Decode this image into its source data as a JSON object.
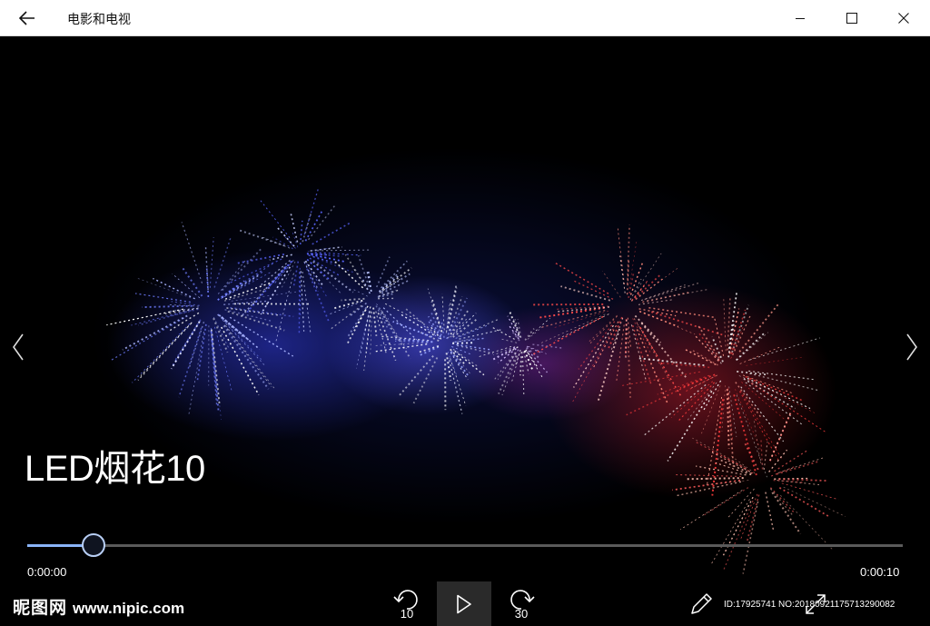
{
  "window": {
    "title": "电影和电视"
  },
  "icons": {
    "back": "back-arrow-icon",
    "minimize": "minimize-icon",
    "maximize": "maximize-icon",
    "close": "close-icon",
    "previous": "chevron-left-icon",
    "next": "chevron-right-icon",
    "skip_back": "skip-back-10-icon",
    "play": "play-icon",
    "skip_forward": "skip-forward-30-icon",
    "edit": "pencil-icon",
    "fullscreen": "expand-icon"
  },
  "video": {
    "title": "LED烟花10",
    "progress": 0.075
  },
  "playback": {
    "current_time": "0:00:00",
    "total_time": "0:00:10",
    "skip_back_seconds": "10",
    "skip_forward_seconds": "30"
  },
  "watermark": {
    "logo_text": "昵图网",
    "site": "www.nipic.com",
    "id_text": "ID:17925741 NO:20180921175713290082"
  },
  "colors": {
    "accent": "#8ab4f8",
    "titlebar_bg": "#ffffff",
    "video_bg": "#000000"
  }
}
